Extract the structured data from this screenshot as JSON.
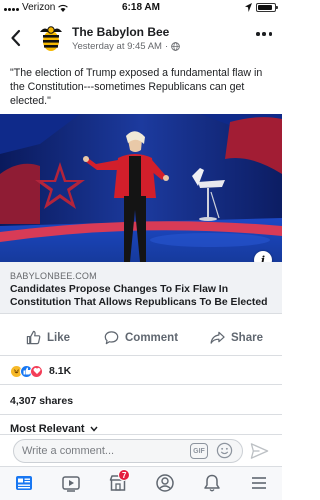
{
  "status_bar": {
    "carrier": "Verizon",
    "time": "6:18 AM",
    "battery_level": 0.9
  },
  "post": {
    "page_name": "The Babylon Bee",
    "timestamp": "Yesterday at 9:45 AM",
    "separator": "·",
    "privacy_icon": "globe-icon",
    "text": "\"The election of Trump exposed a fundamental flaw in the Constitution---sometimes Republicans can get elected.\"",
    "link": {
      "domain": "BABYLONBEE.COM",
      "title": "Candidates Propose Changes To Fix Flaw In Constitution That Allows Republicans To Be Elected"
    }
  },
  "actions": {
    "like": "Like",
    "comment": "Comment",
    "share": "Share"
  },
  "reactions": {
    "count": "8.1K",
    "types": [
      "haha",
      "like",
      "love"
    ]
  },
  "shares": "4,307 shares",
  "sort_label": "Most Relevant",
  "composer": {
    "placeholder": "Write a comment...",
    "gif_label": "GIF"
  },
  "bottom_nav": {
    "items": [
      "news-feed-icon",
      "watch-icon",
      "marketplace-icon",
      "profile-icon",
      "notifications-icon",
      "menu-icon"
    ],
    "marketplace_badge": "7"
  },
  "colors": {
    "accent": "#1877f2",
    "badge": "#e41e3f",
    "image_background": "#0f1f63",
    "logo_yellow": "#f5b800"
  }
}
